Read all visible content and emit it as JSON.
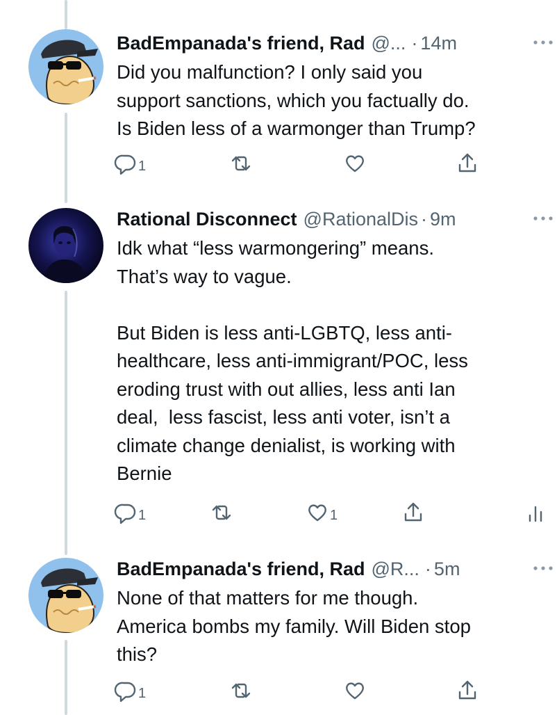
{
  "tweets": [
    {
      "name": "BadEmpanada's friend, Rad",
      "handle": "@...",
      "time": "14m",
      "text": "Did you malfunction? I only said you\nsupport sanctions, which you factually do.\nIs Biden less of a warmonger than Trump?",
      "reply_count": "1",
      "retweet_count": "",
      "like_count": "",
      "avatar_icon": "cartoon-empanada-with-sunglasses-cap"
    },
    {
      "name": "Rational Disconnect",
      "handle": "@RationalDis",
      "time": "9m",
      "text": "Idk what “less warmongering” means.\nThat’s way to vague.\n\nBut Biden is less anti-LGBTQ, less anti-\nhealthcare, less anti-immigrant/POC, less\neroding trust with out allies, less anti Ian\ndeal,  less fascist, less anti voter, isn’t a\nclimate change denialist, is working with\nBernie",
      "reply_count": "1",
      "retweet_count": "",
      "like_count": "1",
      "avatar_icon": "dark-portrait-photo"
    },
    {
      "name": "BadEmpanada's friend, Rad",
      "handle": "@R...",
      "time": "5m",
      "text": "None of that matters for me though.\nAmerica bombs my family. Will Biden stop\nthis?",
      "reply_count": "1",
      "retweet_count": "",
      "like_count": "",
      "avatar_icon": "cartoon-empanada-with-sunglasses-cap"
    }
  ],
  "separator": "·",
  "colors": {
    "text": "#0f1419",
    "secondary": "#536471",
    "thread_line": "#cfd9de",
    "avatar_bg": "#8fc1ec"
  }
}
